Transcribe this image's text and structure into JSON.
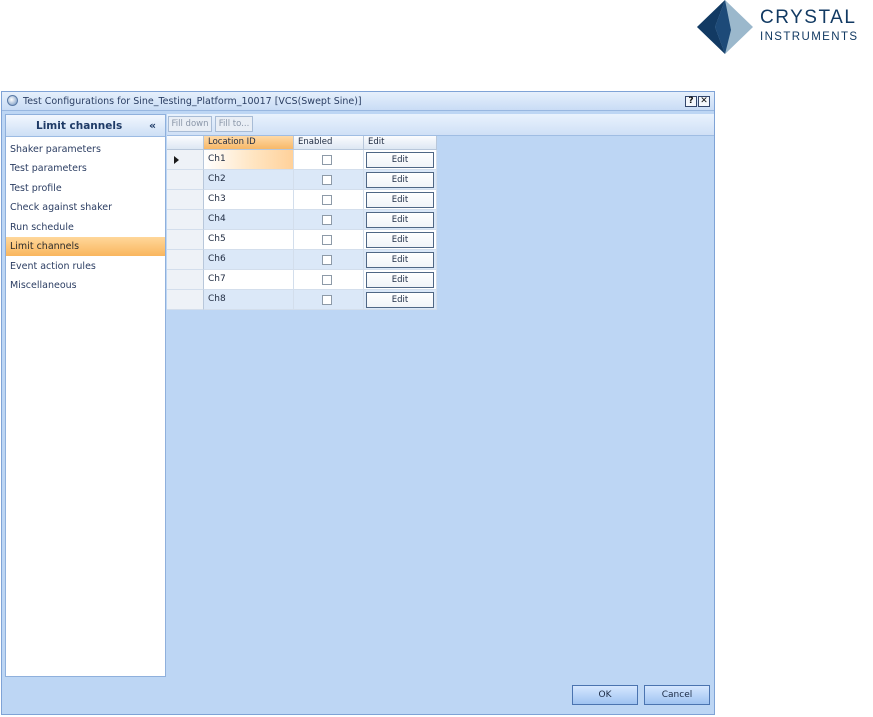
{
  "logo": {
    "line1": "CRYSTAL",
    "line2": "INSTRUMENTS",
    "colors": {
      "dark": "#123a63",
      "light": "#9bb8cc"
    }
  },
  "window": {
    "title": "Test Configurations for Sine_Testing_Platform_10017 [VCS(Swept Sine)]",
    "help_label": "?",
    "close_label": "✕"
  },
  "nav": {
    "title": "Limit channels",
    "collapse_label": "«",
    "items": [
      {
        "label": "Shaker parameters"
      },
      {
        "label": "Test parameters"
      },
      {
        "label": "Test profile"
      },
      {
        "label": "Check against shaker"
      },
      {
        "label": "Run schedule"
      },
      {
        "label": "Limit channels",
        "active": true
      },
      {
        "label": "Event action rules"
      },
      {
        "label": "Miscellaneous"
      }
    ]
  },
  "toolbar": {
    "fill_down": "Fill down",
    "fill_to": "Fill to..."
  },
  "grid": {
    "columns": [
      "Location ID",
      "Enabled",
      "Edit"
    ],
    "rows": [
      {
        "loc": "Ch1",
        "enabled": false,
        "edit": "Edit"
      },
      {
        "loc": "Ch2",
        "enabled": false,
        "edit": "Edit"
      },
      {
        "loc": "Ch3",
        "enabled": false,
        "edit": "Edit"
      },
      {
        "loc": "Ch4",
        "enabled": false,
        "edit": "Edit"
      },
      {
        "loc": "Ch5",
        "enabled": false,
        "edit": "Edit"
      },
      {
        "loc": "Ch6",
        "enabled": false,
        "edit": "Edit"
      },
      {
        "loc": "Ch7",
        "enabled": false,
        "edit": "Edit"
      },
      {
        "loc": "Ch8",
        "enabled": false,
        "edit": "Edit"
      }
    ]
  },
  "footer": {
    "ok": "OK",
    "cancel": "Cancel"
  }
}
